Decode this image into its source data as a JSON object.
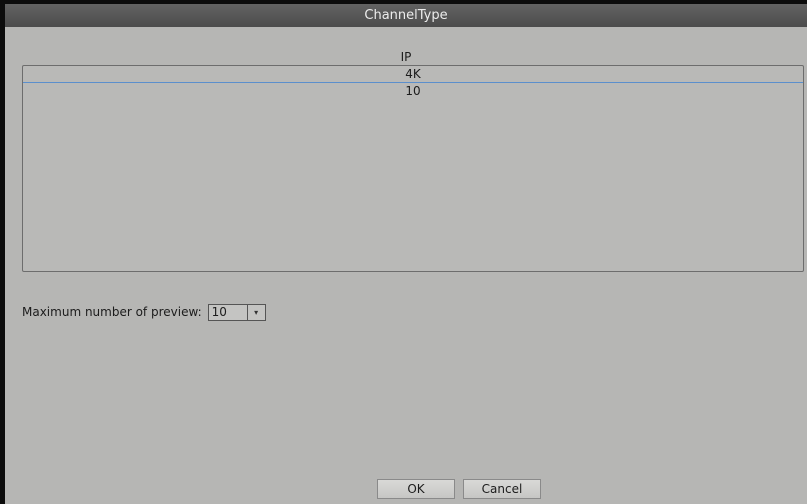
{
  "dialog": {
    "title": "ChannelType"
  },
  "channel_list": {
    "header": "IP",
    "items": [
      "4K",
      "10"
    ],
    "selected_index": 0
  },
  "preview": {
    "label": "Maximum number of preview:",
    "selected_value": "10",
    "arrow": "▾"
  },
  "buttons": {
    "ok": "OK",
    "cancel": "Cancel"
  },
  "colors": {
    "background": "#b6b6b4",
    "titlebar": "#555555",
    "selection_line": "#5b8fcc"
  }
}
